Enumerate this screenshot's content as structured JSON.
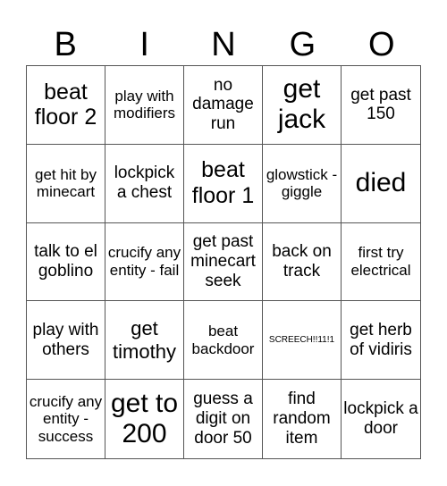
{
  "header": [
    "B",
    "I",
    "N",
    "G",
    "O"
  ],
  "cells": [
    {
      "text": "beat floor 2",
      "size": "s-l"
    },
    {
      "text": "play with modifiers",
      "size": "s-s"
    },
    {
      "text": "no damage run",
      "size": "s-m"
    },
    {
      "text": "get jack",
      "size": "s-xl"
    },
    {
      "text": "get past 150",
      "size": "s-m"
    },
    {
      "text": "get hit by minecart",
      "size": "s-s"
    },
    {
      "text": "lockpick a chest",
      "size": "s-m"
    },
    {
      "text": "beat floor 1",
      "size": "s-l"
    },
    {
      "text": "glowstick - giggle",
      "size": "s-s"
    },
    {
      "text": "died",
      "size": "s-xl"
    },
    {
      "text": "talk to el goblino",
      "size": "s-m"
    },
    {
      "text": "crucify any entity - fail",
      "size": "s-s"
    },
    {
      "text": "get past minecart seek",
      "size": "s-m"
    },
    {
      "text": "back on track",
      "size": "s-m"
    },
    {
      "text": "first try electrical",
      "size": "s-s"
    },
    {
      "text": "play with others",
      "size": "s-m"
    },
    {
      "text": "get timothy",
      "size": "s-ml"
    },
    {
      "text": "beat backdoor",
      "size": "s-s"
    },
    {
      "text": "SCREECH!!11!1",
      "size": "s-xs"
    },
    {
      "text": "get herb of vidiris",
      "size": "s-m"
    },
    {
      "text": "crucify any entity - success",
      "size": "s-s"
    },
    {
      "text": "get to 200",
      "size": "s-xl"
    },
    {
      "text": "guess a digit on door 50",
      "size": "s-m"
    },
    {
      "text": "find random item",
      "size": "s-m"
    },
    {
      "text": "lockpick a door",
      "size": "s-m"
    }
  ]
}
